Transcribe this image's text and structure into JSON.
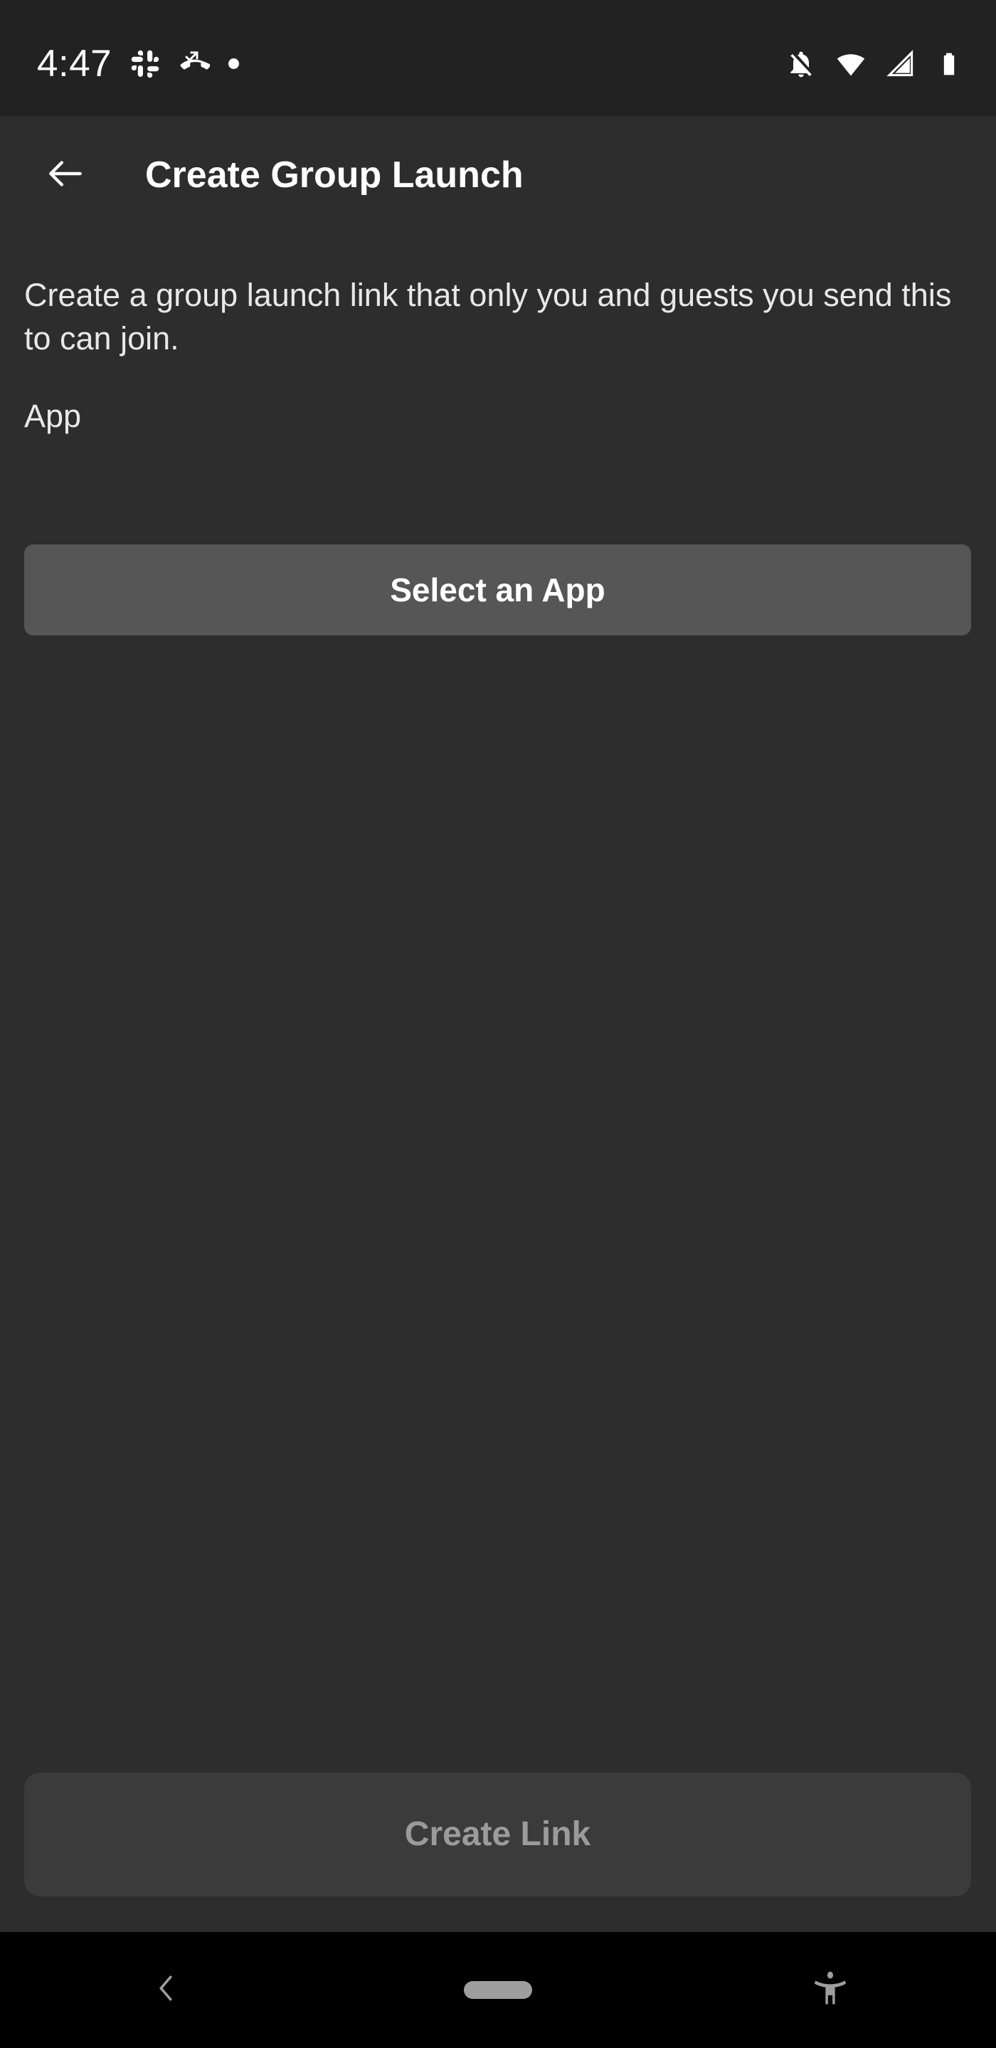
{
  "status_bar": {
    "time": "4:47",
    "left_icons": [
      "slack-icon",
      "missed-call-icon",
      "notification-dot"
    ],
    "right_icons": [
      "silent-mode-icon",
      "wifi-icon",
      "cellular-signal-icon",
      "battery-icon"
    ],
    "background_color": "#222222",
    "icon_color": "#ffffff"
  },
  "app_bar": {
    "back_icon": "arrow-left-icon",
    "title": "Create Group Launch"
  },
  "content": {
    "description": "Create a group launch link that only you and guests you send this to can join.",
    "app_section_label": "App",
    "select_app_button_label": "Select an App",
    "select_app_button_color": "#565656"
  },
  "footer": {
    "create_link_label": "Create Link",
    "create_link_enabled": false,
    "create_link_background": "#3b3b3b",
    "create_link_text_color": "#9b9b9b"
  },
  "nav_bar": {
    "background_color": "#000000",
    "items": [
      {
        "name": "back",
        "icon": "chevron-left-icon"
      },
      {
        "name": "home",
        "icon": "home-pill-icon"
      },
      {
        "name": "accessibility",
        "icon": "accessibility-icon"
      }
    ]
  },
  "theme": {
    "background": "#2d2d2d",
    "text_primary": "#ffffff",
    "text_secondary": "#e8e8e8"
  }
}
